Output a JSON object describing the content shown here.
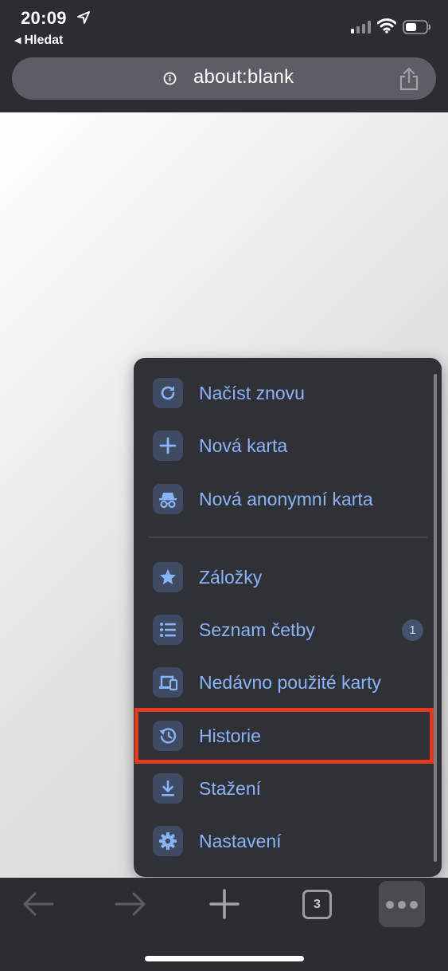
{
  "status_bar": {
    "time": "20:09",
    "back_app": "Hledat"
  },
  "url_bar": {
    "url": "about:blank"
  },
  "menu": {
    "items": [
      {
        "label": "Načíst znovu",
        "icon": "reload-icon"
      },
      {
        "label": "Nová karta",
        "icon": "plus-icon"
      },
      {
        "label": "Nová anonymní karta",
        "icon": "incognito-icon"
      },
      {
        "label": "Záložky",
        "icon": "star-icon"
      },
      {
        "label": "Seznam četby",
        "icon": "list-icon",
        "badge": "1"
      },
      {
        "label": "Nedávno použité karty",
        "icon": "devices-icon"
      },
      {
        "label": "Historie",
        "icon": "history-icon"
      },
      {
        "label": "Stažení",
        "icon": "download-icon"
      },
      {
        "label": "Nastavení",
        "icon": "gear-icon"
      }
    ],
    "highlighted_item": "Historie",
    "highlight_color": "#e5391f",
    "accent_color": "#8ab4f8"
  },
  "toolbar": {
    "tab_count": "3"
  }
}
